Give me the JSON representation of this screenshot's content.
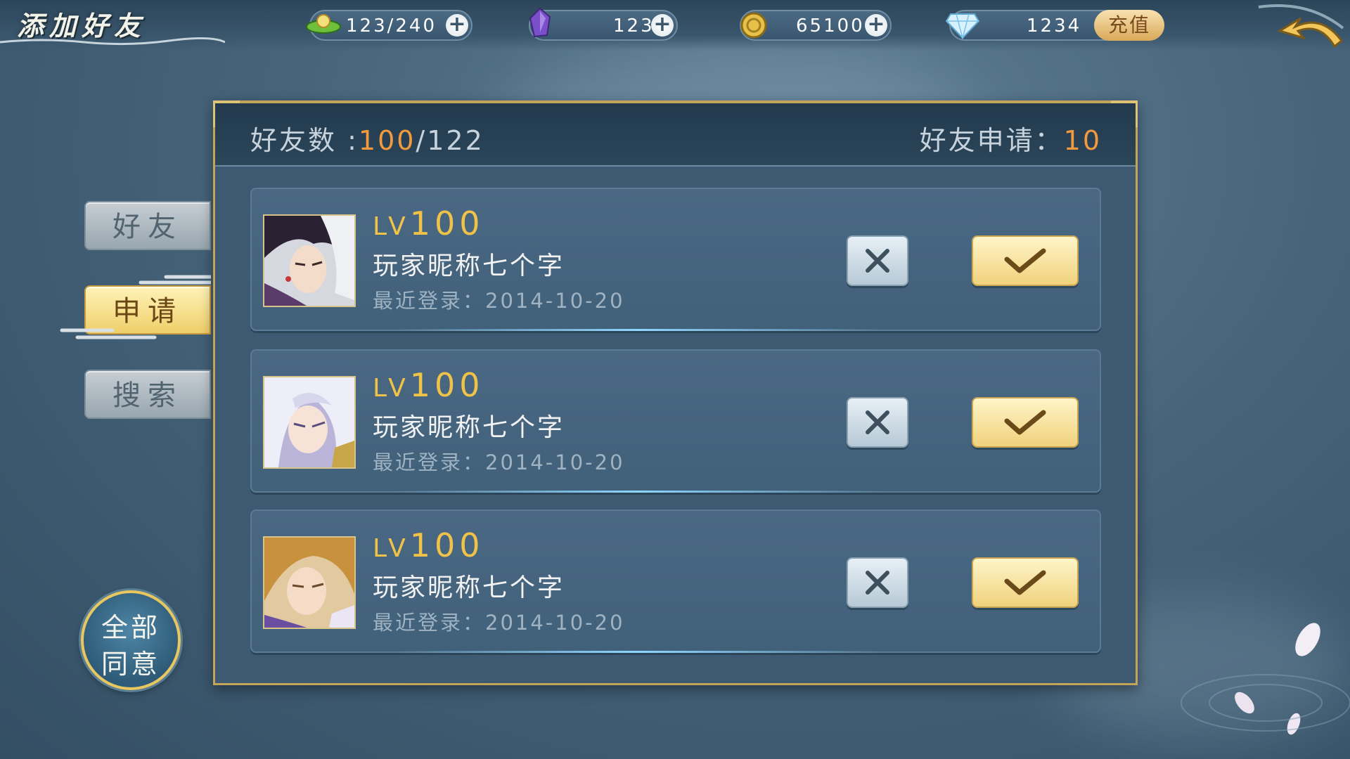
{
  "header": {
    "title": "添加好友",
    "stamina": "123/240",
    "gems": "123",
    "coins": "65100",
    "diamonds": "1234",
    "recharge_label": "充值"
  },
  "tabs": [
    {
      "label": "好友",
      "active": false
    },
    {
      "label": "申请",
      "active": true
    },
    {
      "label": "搜索",
      "active": false
    }
  ],
  "agree_all": {
    "line1": "全部",
    "line2": "同意"
  },
  "panel": {
    "friend_count_label": "好友数 :",
    "friend_count_current": "100",
    "friend_count_total": "/122",
    "requests_label": "好友申请：",
    "requests_count": "10"
  },
  "requests": [
    {
      "level_prefix": "LV",
      "level": "100",
      "nickname": "玩家昵称七个字",
      "last_login": "最近登录：2014-10-20",
      "avatar_icon": "dark-haired-character-portrait"
    },
    {
      "level_prefix": "LV",
      "level": "100",
      "nickname": "玩家昵称七个字",
      "last_login": "最近登录：2014-10-20",
      "avatar_icon": "white-haired-character-portrait"
    },
    {
      "level_prefix": "LV",
      "level": "100",
      "nickname": "玩家昵称七个字",
      "last_login": "最近登录：2014-10-20",
      "avatar_icon": "blond-character-portrait"
    }
  ],
  "colors": {
    "accent_gold": "#f0c348",
    "count_orange": "#f39a3c",
    "panel_bg": "#3d5a72"
  }
}
